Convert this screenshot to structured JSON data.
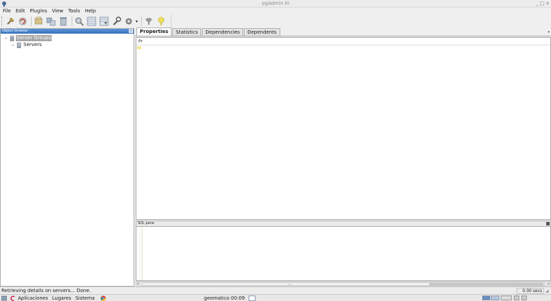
{
  "window": {
    "title": "pgAdmin III",
    "controls": [
      "_",
      "□",
      "×"
    ]
  },
  "menubar": {
    "items": [
      "File",
      "Edit",
      "Plugins",
      "View",
      "Tools",
      "Help"
    ]
  },
  "toolbar": {
    "icons": [
      "connect-icon",
      "refresh-icon",
      "properties-icon",
      "create-object-icon",
      "drop-object-icon",
      "sql-query-icon",
      "view-data-icon",
      "filtered-data-icon",
      "maintenance-icon",
      "plugins-icon",
      "guru-hint-icon",
      "help-icon"
    ]
  },
  "object_browser": {
    "title": "Object browser",
    "close": "×",
    "tree": [
      {
        "expander": "−",
        "label": "Server Groups",
        "selected": true
      },
      {
        "expander": "−",
        "label": "Servers",
        "selected": false
      }
    ]
  },
  "tabs": [
    "Properties",
    "Statistics",
    "Dependencies",
    "Dependents"
  ],
  "tab_dropdown": "▾",
  "properties": {
    "column_header": "Pr",
    "row_marker": "⋯"
  },
  "sql_pane": {
    "title": "SQL pane"
  },
  "statusbar": {
    "text": "Retrieving details on servers... Done.",
    "time": "0.00 secs"
  },
  "taskbar": {
    "items": [
      "Aplicaciones",
      "Lugares",
      "Sistema"
    ],
    "active_window": "geomatico 00:09",
    "colors": {
      "accent": "#3973be",
      "debian_red": "#c70036"
    }
  }
}
